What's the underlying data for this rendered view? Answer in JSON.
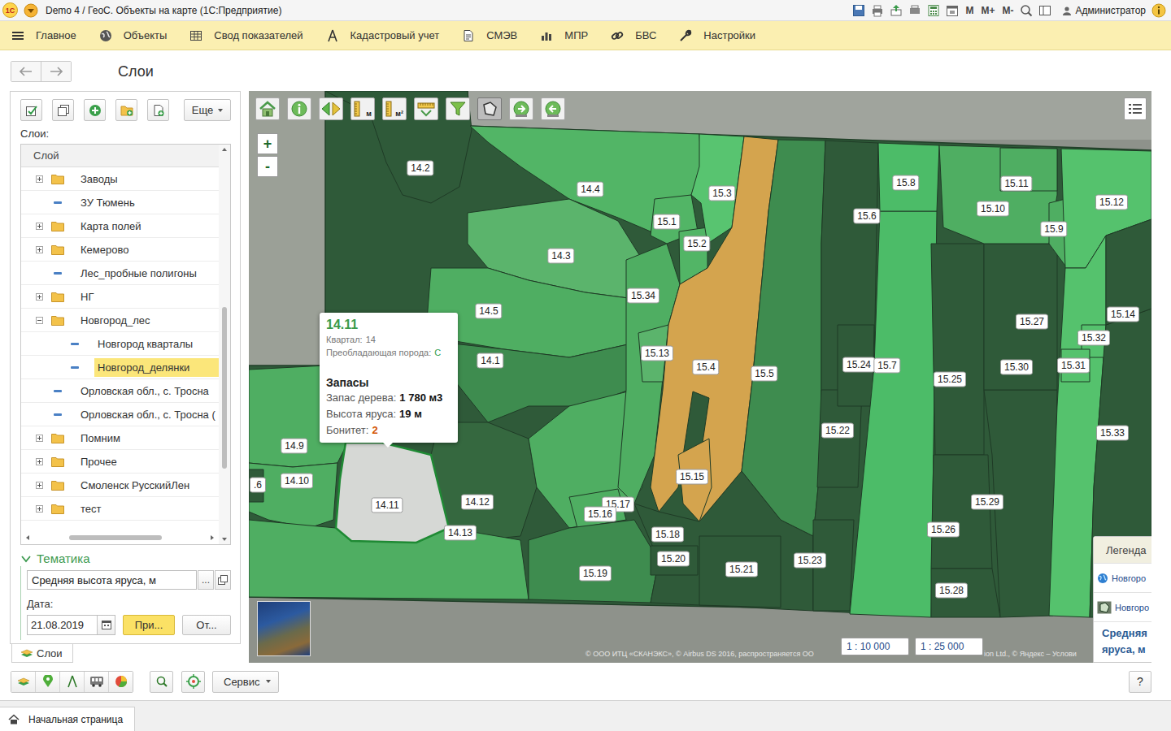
{
  "window": {
    "logo": "1С",
    "title": "Demo 4 / ГеоС. Объекты на карте  (1С:Предприятие)",
    "memory": [
      "М",
      "М+",
      "М-"
    ],
    "user": "Администратор"
  },
  "menu": [
    {
      "label": "Главное"
    },
    {
      "label": "Объекты"
    },
    {
      "label": "Свод показателей"
    },
    {
      "label": "Кадастровый учет"
    },
    {
      "label": "СМЭВ"
    },
    {
      "label": "МПР"
    },
    {
      "label": "БВС"
    },
    {
      "label": "Настройки"
    }
  ],
  "page": {
    "title": "Слои"
  },
  "layers": {
    "more": "Еще",
    "label": "Слои:",
    "column": "Слой",
    "items": [
      {
        "label": "Заводы",
        "kind": "folder",
        "depth": 0,
        "expanded": false,
        "selected": false
      },
      {
        "label": "ЗУ Тюмень",
        "kind": "layer",
        "depth": 0,
        "expanded": false,
        "selected": false
      },
      {
        "label": "Карта полей",
        "kind": "folder",
        "depth": 0,
        "expanded": false,
        "selected": false
      },
      {
        "label": "Кемерово",
        "kind": "folder",
        "depth": 0,
        "expanded": false,
        "selected": false
      },
      {
        "label": "Лес_пробные полигоны",
        "kind": "layer",
        "depth": 0,
        "expanded": false,
        "selected": false
      },
      {
        "label": "НГ",
        "kind": "folder",
        "depth": 0,
        "expanded": false,
        "selected": false
      },
      {
        "label": "Новгород_лес",
        "kind": "folder",
        "depth": 0,
        "expanded": true,
        "selected": false
      },
      {
        "label": "Новгород кварталы",
        "kind": "layer",
        "depth": 1,
        "expanded": false,
        "selected": false
      },
      {
        "label": "Новгород_делянки",
        "kind": "layer",
        "depth": 1,
        "expanded": false,
        "selected": true
      },
      {
        "label": "Орловская обл., с. Тросна",
        "kind": "layer",
        "depth": 0,
        "expanded": false,
        "selected": false
      },
      {
        "label": "Орловская обл., с. Тросна (",
        "kind": "layer",
        "depth": 0,
        "expanded": false,
        "selected": false
      },
      {
        "label": "Помним",
        "kind": "folder",
        "depth": 0,
        "expanded": false,
        "selected": false
      },
      {
        "label": "Прочее",
        "kind": "folder",
        "depth": 0,
        "expanded": false,
        "selected": false
      },
      {
        "label": "Смоленск РусскийЛен",
        "kind": "folder",
        "depth": 0,
        "expanded": false,
        "selected": false
      },
      {
        "label": "тест",
        "kind": "folder",
        "depth": 0,
        "expanded": false,
        "selected": false
      }
    ],
    "scroll": {
      "vertical": {
        "position": 0.4,
        "size": 0.43
      },
      "horizontal": {
        "position": 0.2,
        "size": 0.55
      }
    }
  },
  "thematic": {
    "title": "Тематика",
    "expanded": true,
    "field": "Средняя высота яруса, м",
    "ellipsis": "...",
    "date_label": "Дата:",
    "date": "21.08.2019",
    "apply": "При...",
    "other": "От..."
  },
  "side_tabs": [
    {
      "label": "Слои",
      "selected": true
    }
  ],
  "map": {
    "tools": [
      {
        "kind": "home",
        "selected": false
      },
      {
        "kind": "info",
        "selected": false
      },
      {
        "kind": "arrows",
        "selected": false
      },
      {
        "kind": "ruler",
        "unit": "м",
        "selected": false
      },
      {
        "kind": "ruler",
        "unit": "м²",
        "selected": false
      },
      {
        "kind": "measure",
        "selected": false
      },
      {
        "kind": "filter",
        "selected": false
      },
      {
        "kind": "polygon",
        "selected": true
      },
      {
        "kind": "export",
        "selected": false
      },
      {
        "kind": "import",
        "selected": false
      }
    ],
    "zoom": [
      "+",
      "-"
    ],
    "parcels": [
      {
        "label": "14.2",
        "color": "#2f5a39",
        "selected": false
      },
      {
        "label": "14.4",
        "color": "#52b566",
        "selected": false
      },
      {
        "label": "14.3",
        "color": "#5bb46c",
        "selected": false
      },
      {
        "label": "14.5",
        "color": "#4fae62",
        "selected": false
      },
      {
        "label": "14.1",
        "color": "#3e8c4f",
        "selected": false
      },
      {
        "label": "14.9",
        "color": "#4fae62",
        "selected": false
      },
      {
        "label": "14.10",
        "color": "#4fae62",
        "selected": false
      },
      {
        "label": ".6",
        "color": "#2f5a39",
        "selected": false
      },
      {
        "label": "14.12",
        "color": "#35683f",
        "selected": false
      },
      {
        "label": "14.13",
        "color": "#4fae62",
        "selected": false
      },
      {
        "label": "14.11",
        "color": "#d6d8d5",
        "selected": true
      },
      {
        "label": "15.17",
        "color": "#4fae62",
        "selected": false
      },
      {
        "label": "15.16",
        "color": "#4fae62",
        "selected": false
      },
      {
        "label": "15.19",
        "color": "#3e8c4f",
        "selected": false
      },
      {
        "label": "15.18",
        "color": "#2f5a39",
        "selected": false
      },
      {
        "label": "15.20",
        "color": "#2f5a39",
        "selected": false
      },
      {
        "label": "15.21",
        "color": "#2f5a39",
        "selected": false
      },
      {
        "label": "15.34",
        "color": "#4fae62",
        "selected": false
      },
      {
        "label": "15.13",
        "color": "#5bb46c",
        "selected": false
      },
      {
        "label": "15.1",
        "color": "#52b566",
        "selected": false
      },
      {
        "label": "15.2",
        "color": "#52b566",
        "selected": false
      },
      {
        "label": "15.3",
        "color": "#58c470",
        "selected": false
      },
      {
        "label": "15.4",
        "color": "#d4a44e",
        "selected": false
      },
      {
        "label": "15.15",
        "color": "#d4a44e",
        "selected": false
      },
      {
        "label": "15.5",
        "color": "#3e8c4f",
        "selected": false
      },
      {
        "label": "15.6",
        "color": "#2f5a39",
        "selected": false
      },
      {
        "label": "15.22",
        "color": "#2f5a39",
        "selected": false
      },
      {
        "label": "15.23",
        "color": "#2f5a39",
        "selected": false
      },
      {
        "label": "15.24",
        "color": "#2f5a39",
        "selected": false
      },
      {
        "label": "15.7",
        "color": "#4cbc68",
        "selected": false
      },
      {
        "label": "15.8",
        "color": "#4cbc68",
        "selected": false
      },
      {
        "label": "15.25",
        "color": "#2f5a39",
        "selected": false
      },
      {
        "label": "15.26",
        "color": "#2f5a39",
        "selected": false
      },
      {
        "label": "15.28",
        "color": "#2f5a39",
        "selected": false
      },
      {
        "label": "15.29",
        "color": "#2f5a39",
        "selected": false
      },
      {
        "label": "15.30",
        "color": "#2f5a39",
        "selected": false
      },
      {
        "label": "15.10",
        "color": "#4fae62",
        "selected": false
      },
      {
        "label": "15.11",
        "color": "#4fae62",
        "selected": false
      },
      {
        "label": "15.9",
        "color": "#4fae62",
        "selected": false
      },
      {
        "label": "15.12",
        "color": "#55c26d",
        "selected": false
      },
      {
        "label": "15.27",
        "color": "#55c26d",
        "selected": false
      },
      {
        "label": "15.32",
        "color": "#55c26d",
        "selected": false
      },
      {
        "label": "15.31",
        "color": "#55c26d",
        "selected": false
      },
      {
        "label": "15.33",
        "color": "#2f5a39",
        "selected": false
      },
      {
        "label": "15.14",
        "color": "#2f5a39",
        "selected": false
      }
    ],
    "popup": {
      "title": "14.11",
      "rows": [
        {
          "label": "Квартал:",
          "value": "14",
          "color": "#777777"
        },
        {
          "label": "Преобладающая порода:",
          "value": "С",
          "color": "#2e9e4f"
        }
      ],
      "section": "Запасы",
      "stats": [
        {
          "label": "Запас дерева:",
          "value": "1 780 м3",
          "color": "#111111"
        },
        {
          "label": "Высота яруса:",
          "value": "19 м",
          "color": "#111111"
        },
        {
          "label": "Бонитет:",
          "value": "2",
          "color": "#d35400"
        }
      ]
    },
    "scales": [
      "1 : 10 000",
      "1 : 25 000"
    ],
    "attribution": [
      "© ООО ИТЦ «СКАНЭКС», © Airbus DS 2016, распространяется ОО",
      "ion Ltd., © Яндекс – Услови"
    ],
    "legend": {
      "title": "Легенда",
      "items": [
        {
          "label": "Новгоро",
          "kind": "raster"
        },
        {
          "label": "Новгоро",
          "kind": "polygon"
        }
      ],
      "thematic": [
        "Средняя",
        "яруса, м"
      ]
    }
  },
  "toolbar": {
    "service": "Сервис",
    "help": "?"
  },
  "footer": {
    "tabs": [
      {
        "label": "Начальная страница",
        "selected": true
      }
    ]
  }
}
